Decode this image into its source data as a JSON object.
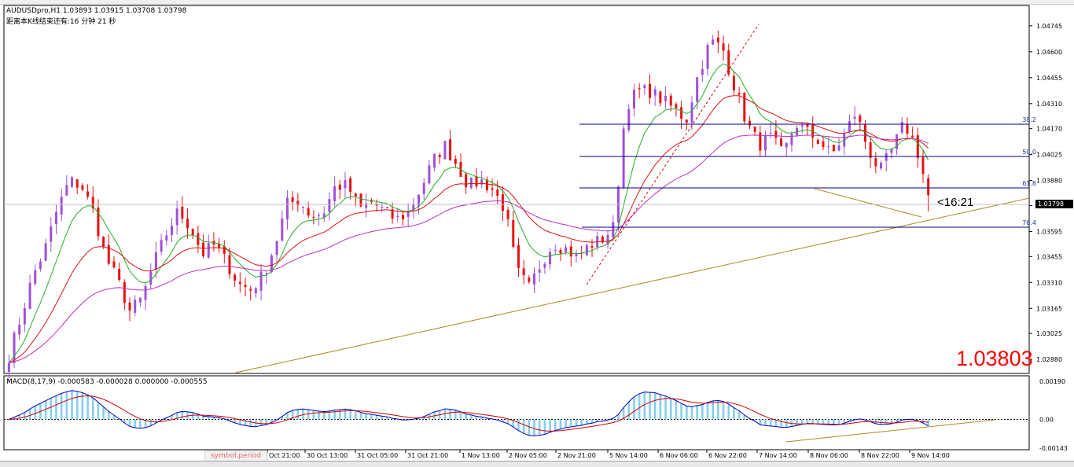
{
  "header": {
    "symbol_line": "AUDUSDpro,H1  1.03893 1.03915 1.03708 1.03798",
    "timer_line": "距离本K线结束还有:16 分钟 21 秒"
  },
  "price_axis": {
    "labels": [
      "1.04745",
      "1.04600",
      "1.04455",
      "1.04310",
      "1.04170",
      "1.04025",
      "1.03880",
      "1.03740",
      "1.03595",
      "1.03455",
      "1.03310",
      "1.03165",
      "1.03025",
      "1.02880"
    ],
    "current": "1.03798"
  },
  "fibonacci": {
    "levels": [
      "38.2",
      "50.0",
      "61.8",
      "76.4"
    ]
  },
  "overlay": {
    "countdown": "<16:21",
    "big_price": "1.03803"
  },
  "macd": {
    "title": "MACD(8,17,9) -0.000583 -0.000028 0.000000 -0.000555",
    "axis_labels": [
      "0.00190",
      "0.00",
      "-0.00143"
    ]
  },
  "time_axis": [
    "Oct 21:00",
    "30 Oct 13:00",
    "31 Oct 05:00",
    "31 Oct 21:00",
    "1 Nov 13:00",
    "2 Nov 05:00",
    "2 Nov 21:00",
    "5 Nov 14:00",
    "6 Nov 06:00",
    "6 Nov 22:00",
    "7 Nov 14:00",
    "8 Nov 06:00",
    "8 Nov 22:00",
    "9 Nov 14:00"
  ],
  "tab": {
    "label": "symbol,period"
  },
  "colors": {
    "bull": "#a050d8",
    "bear": "#e81010",
    "ma_fast": "#20b020",
    "ma_mid": "#e01010",
    "ma_slow": "#c030c0",
    "trend": "#b08820",
    "fib": "#000080",
    "hist": "#87ceeb",
    "macd": "#0000c0",
    "signal": "#d00000"
  },
  "chart_data": {
    "type": "candlestick",
    "symbol": "AUDUSDpro",
    "timeframe": "H1",
    "ylim": [
      1.0281,
      1.0485
    ],
    "last_ohlc": {
      "open": 1.03893,
      "high": 1.03915,
      "low": 1.03708,
      "close": 1.03798
    },
    "anchors": [
      [
        "28 Oct",
        1.029
      ],
      [
        "",
        1.0312
      ],
      [
        "",
        1.0335
      ],
      [
        "",
        1.035
      ],
      [
        "",
        1.0372
      ],
      [
        "",
        1.0388
      ],
      [
        "",
        1.0385
      ],
      [
        "",
        1.037
      ],
      [
        "",
        1.0345
      ],
      [
        "",
        1.0332
      ],
      [
        "",
        1.0315
      ],
      [
        "",
        1.0322
      ],
      [
        "",
        1.0342
      ],
      [
        "",
        1.0358
      ],
      [
        "",
        1.0371
      ],
      [
        "",
        1.0362
      ],
      [
        "",
        1.0347
      ],
      [
        "",
        1.0352
      ],
      [
        "",
        1.0342
      ],
      [
        "",
        1.033
      ],
      [
        "",
        1.0327
      ],
      [
        "",
        1.0335
      ],
      [
        "",
        1.0352
      ],
      [
        "",
        1.0375
      ],
      [
        "",
        1.0377
      ],
      [
        "",
        1.0368
      ],
      [
        "",
        1.037
      ],
      [
        "",
        1.0385
      ],
      [
        "",
        1.0385
      ],
      [
        "",
        1.0372
      ],
      [
        "",
        1.0376
      ],
      [
        "",
        1.0371
      ],
      [
        "",
        1.0366
      ],
      [
        "",
        1.037
      ],
      [
        "",
        1.0383
      ],
      [
        "",
        1.0398
      ],
      [
        "",
        1.0408
      ],
      [
        "",
        1.0397
      ],
      [
        "",
        1.0385
      ],
      [
        "",
        1.0388
      ],
      [
        "",
        1.0383
      ],
      [
        "",
        1.0372
      ],
      [
        "",
        1.0337
      ],
      [
        "",
        1.0328
      ],
      [
        "",
        1.0342
      ],
      [
        "",
        1.0353
      ],
      [
        "",
        1.035
      ],
      [
        "",
        1.0345
      ],
      [
        "",
        1.0352
      ],
      [
        "",
        1.0355
      ],
      [
        "",
        1.0362
      ],
      [
        "",
        1.043
      ],
      [
        "",
        1.0438
      ],
      [
        "",
        1.0438
      ],
      [
        "",
        1.0433
      ],
      [
        "",
        1.0428
      ],
      [
        "",
        1.0422
      ],
      [
        "",
        1.0448
      ],
      [
        "",
        1.0466
      ],
      [
        "",
        1.0462
      ],
      [
        "",
        1.044
      ],
      [
        "",
        1.042
      ],
      [
        "",
        1.0408
      ],
      [
        "",
        1.0412
      ],
      [
        "",
        1.0402
      ],
      [
        "",
        1.042
      ],
      [
        "",
        1.0415
      ],
      [
        "",
        1.041
      ],
      [
        "",
        1.0402
      ],
      [
        "",
        1.0413
      ],
      [
        "",
        1.0426
      ],
      [
        "",
        1.0406
      ],
      [
        "",
        1.0393
      ],
      [
        "",
        1.0405
      ],
      [
        "",
        1.042
      ],
      [
        "",
        1.0407
      ],
      [
        "9 Nov",
        1.038
      ]
    ],
    "moving_averages": [
      "fast (green)",
      "mid (red)",
      "slow (magenta)"
    ],
    "fib_levels": [
      "38.2",
      "50.0",
      "61.8",
      "76.4"
    ],
    "macd": {
      "fast": 8,
      "slow": 17,
      "signal": 9,
      "values": [
        -0.000583,
        -2.8e-05,
        0.0,
        -0.000555
      ],
      "ylim": [
        -0.00143,
        0.0019
      ]
    }
  }
}
